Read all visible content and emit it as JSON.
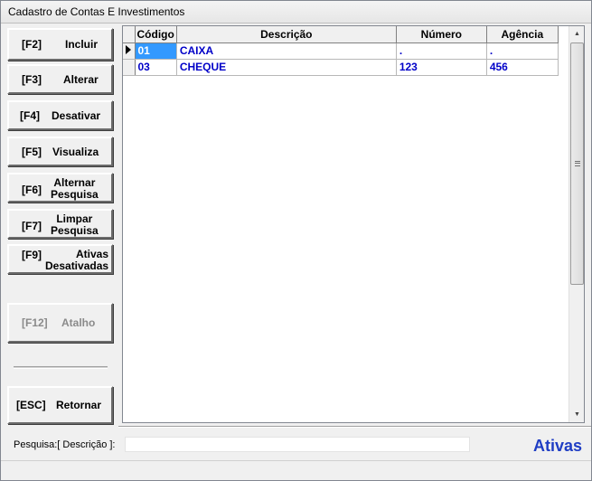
{
  "window": {
    "title": "Cadastro de Contas E Investimentos"
  },
  "buttons": [
    {
      "key": "[F2]",
      "label": "Incluir"
    },
    {
      "key": "[F3]",
      "label": "Alterar"
    },
    {
      "key": "[F4]",
      "label": "Desativar"
    },
    {
      "key": "[F5]",
      "label": "Visualiza"
    },
    {
      "key": "[F6]",
      "label": "Alternar\nPesquisa"
    },
    {
      "key": "[F7]",
      "label": "Limpar\nPesquisa"
    },
    {
      "key": "[F9]",
      "label": "Ativas\nDesativadas"
    },
    {
      "key": "[F12]",
      "label": "Atalho"
    },
    {
      "key": "[ESC]",
      "label": "Retornar"
    }
  ],
  "grid": {
    "columns": [
      "Código",
      "Descrição",
      "Número",
      "Agência"
    ],
    "rows": [
      {
        "codigo": "01",
        "descricao": "CAIXA",
        "numero": ".",
        "agencia": "."
      },
      {
        "codigo": "03",
        "descricao": "CHEQUE",
        "numero": "123",
        "agencia": "456"
      }
    ]
  },
  "search": {
    "label": "Pesquisa:[  Descrição  ]:",
    "value": ""
  },
  "status": {
    "filter": "Ativas"
  },
  "colors": {
    "cell_text": "#0000c8",
    "status_text": "#1f3dc4",
    "selection": "#3399ff"
  }
}
